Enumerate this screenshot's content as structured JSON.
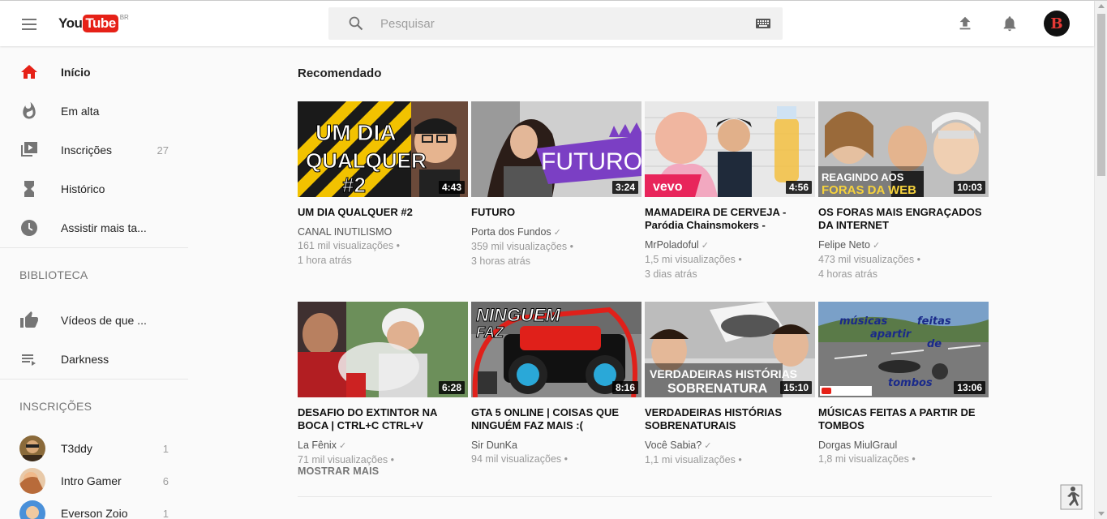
{
  "header": {
    "logo_you": "You",
    "logo_tube": "Tube",
    "logo_region": "BR",
    "search_placeholder": "Pesquisar",
    "avatar_letter": "B"
  },
  "sidebar": {
    "nav": [
      {
        "label": "Início",
        "icon": "home-icon",
        "active": true
      },
      {
        "label": "Em alta",
        "icon": "trending-flame-icon"
      },
      {
        "label": "Inscrições",
        "icon": "subscriptions-icon",
        "count": "27"
      },
      {
        "label": "Histórico",
        "icon": "history-hourglass-icon"
      },
      {
        "label": "Assistir mais ta...",
        "icon": "watch-later-clock-icon"
      }
    ],
    "library_heading": "BIBLIOTECA",
    "library": [
      {
        "label": "Vídeos de que ...",
        "icon": "thumbs-up-icon"
      },
      {
        "label": "Darkness",
        "icon": "playlist-icon"
      }
    ],
    "subscriptions_heading": "INSCRIÇÕES",
    "subscriptions": [
      {
        "label": "T3ddy",
        "count": "1"
      },
      {
        "label": "Intro Gamer",
        "count": "6"
      },
      {
        "label": "Everson Zoio",
        "count": "1"
      }
    ]
  },
  "main": {
    "section_title": "Recomendado",
    "show_more": "MOSTRAR MAIS",
    "videos": [
      {
        "title": "UM DIA QUALQUER #2",
        "channel": "CANAL INUTILISMO",
        "verified": false,
        "views": "161 mil visualizações",
        "age": "1 hora atrás",
        "duration": "4:43",
        "thumb_text_1": "UM DIA",
        "thumb_text_2": "QUALQUER",
        "thumb_text_3": "#2"
      },
      {
        "title": "FUTURO",
        "channel": "Porta dos Fundos",
        "verified": true,
        "views": "359 mil visualizações",
        "age": "3 horas atrás",
        "duration": "3:24",
        "thumb_text_1": "FUTURO"
      },
      {
        "title": "MAMADEIRA DE CERVEJA - Paródia Chainsmokers -",
        "channel": "MrPoladoful",
        "verified": true,
        "views": "1,5 mi visualizações",
        "age": "3 dias atrás",
        "duration": "4:56",
        "thumb_text_1": "vevo"
      },
      {
        "title": "OS FORAS MAIS ENGRAÇADOS DA INTERNET",
        "channel": "Felipe Neto",
        "verified": true,
        "views": "473 mil visualizações",
        "age": "4 horas atrás",
        "duration": "10:03",
        "thumb_text_1": "REAGINDO AOS",
        "thumb_text_2": "FORAS DA WEB"
      },
      {
        "title": "DESAFIO DO EXTINTOR NA BOCA | CTRL+C CTRL+V",
        "channel": "La Fênix",
        "verified": true,
        "views": "71 mil visualizações",
        "age": "",
        "duration": "6:28"
      },
      {
        "title": "GTA 5 ONLINE | COISAS QUE NINGUÉM FAZ MAIS :(",
        "channel": "Sir DunKa",
        "verified": false,
        "views": "94 mil visualizações",
        "age": "",
        "duration": "8:16",
        "thumb_text_1": "NINGUEM",
        "thumb_text_2": "FAZ"
      },
      {
        "title": "VERDADEIRAS HISTÓRIAS SOBRENATURAIS",
        "channel": "Você Sabia?",
        "verified": true,
        "views": "1,1 mi visualizações",
        "age": "",
        "duration": "15:10",
        "thumb_text_1": "VERDADEIRAS HISTÓRIAS",
        "thumb_text_2": "SOBRENATURA"
      },
      {
        "title": "MÚSICAS FEITAS A PARTIR DE TOMBOS",
        "channel": "Dorgas MiulGraul",
        "verified": false,
        "views": "1,8 mi visualizações",
        "age": "",
        "duration": "13:06",
        "thumb_text_1": "músicas",
        "thumb_text_2": "feitas",
        "thumb_text_3": "apartir",
        "thumb_text_4": "de",
        "thumb_text_5": "tombos"
      }
    ]
  },
  "colors": {
    "brand": "#e62117",
    "text_secondary": "#555555",
    "meta": "#999999"
  }
}
